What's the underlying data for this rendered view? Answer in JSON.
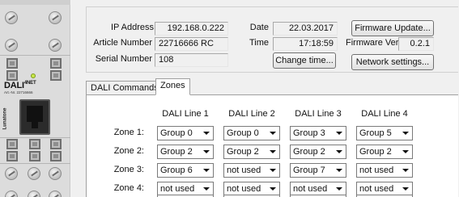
{
  "device": {
    "logo": "DALI",
    "logo_suffix": "4NET",
    "article_print": "Art.-Nr. 22716666",
    "brand": "Lunatone"
  },
  "info": {
    "ip_address_label": "IP Address",
    "ip_address_value": "192.168.0.222",
    "article_number_label": "Article Number",
    "article_number_value": "22716666 RC",
    "serial_number_label": "Serial Number",
    "serial_number_value": "108",
    "date_label": "Date",
    "date_value": "22.03.2017",
    "time_label": "Time",
    "time_value": "17:18:59",
    "firmware_ver_label": "Firmware Ver",
    "firmware_ver_value": "0.2.1"
  },
  "buttons": {
    "firmware_update": "Firmware Update...",
    "change_time": "Change time...",
    "network_settings": "Network settings..."
  },
  "tabs": [
    {
      "label": "DALI Commands",
      "active": false
    },
    {
      "label": "Zones",
      "active": true
    }
  ],
  "zones": {
    "columns": [
      "DALI Line 1",
      "DALI Line 2",
      "DALI Line 3",
      "DALI Line 4"
    ],
    "rows": [
      {
        "label": "Zone 1:",
        "values": [
          "Group 0",
          "Group 0",
          "Group 3",
          "Group 5"
        ]
      },
      {
        "label": "Zone 2:",
        "values": [
          "Group 2",
          "Group 2",
          "Group 2",
          "Group 2"
        ]
      },
      {
        "label": "Zone 3:",
        "values": [
          "Group 6",
          "not used",
          "Group 7",
          "not used"
        ]
      },
      {
        "label": "Zone 4:",
        "values": [
          "not used",
          "not used",
          "not used",
          "not used"
        ]
      },
      {
        "label": "",
        "values": [
          "",
          "",
          "",
          ""
        ]
      }
    ]
  },
  "colors": {
    "window_bg": "#f0f0f0",
    "device_bg": "#dcdcdc",
    "status_led": "#c9e84a"
  }
}
